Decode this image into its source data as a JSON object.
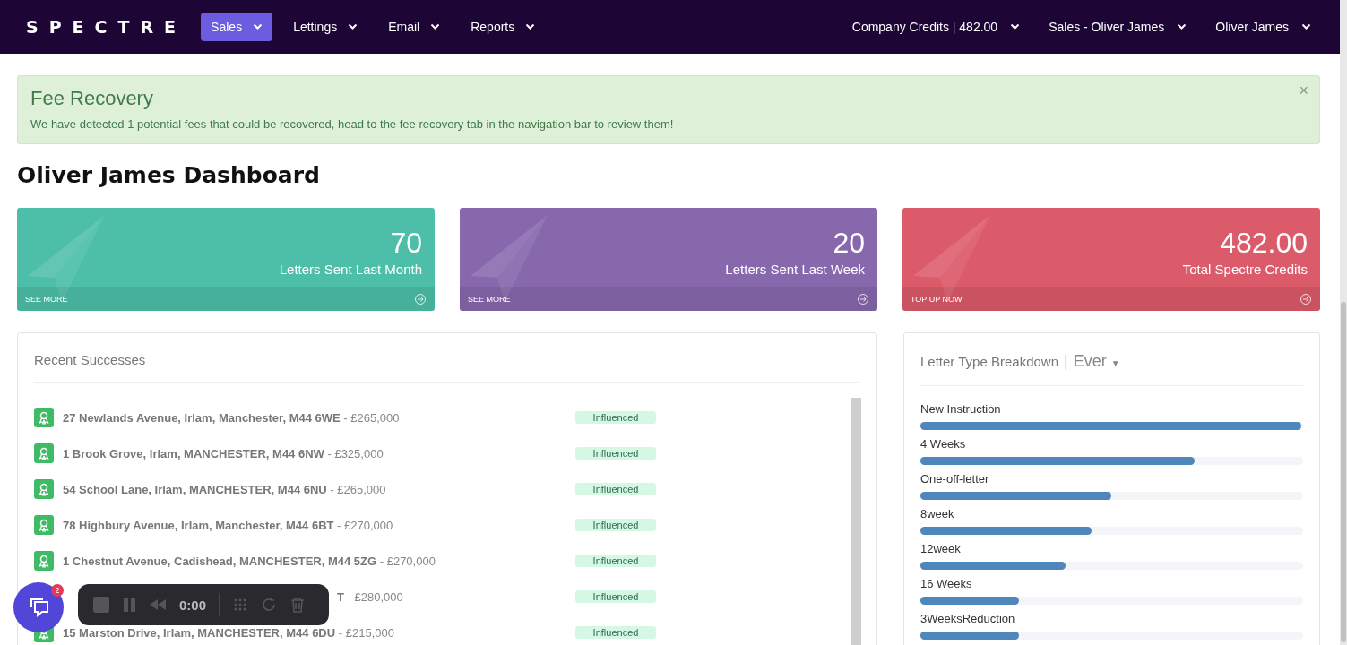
{
  "nav": {
    "logo": "SPECTRE",
    "items": [
      {
        "label": "Sales",
        "selected": true
      },
      {
        "label": "Lettings",
        "selected": false
      },
      {
        "label": "Email",
        "selected": false
      },
      {
        "label": "Reports",
        "selected": false
      }
    ],
    "right_items": [
      "Company Credits | 482.00",
      "Sales - Oliver James",
      "Oliver James"
    ]
  },
  "alert": {
    "title": "Fee Recovery",
    "message": "We have detected 1 potential fees that could be recovered, head to the fee recovery tab in the navigation bar to review them!",
    "close": "×"
  },
  "heading": "Oliver James Dashboard",
  "stats": [
    {
      "value": "70",
      "label": "Letters Sent Last Month",
      "link": "SEE MORE",
      "color": "#4dbfa9"
    },
    {
      "value": "20",
      "label": "Letters Sent Last Week",
      "link": "SEE MORE",
      "color": "#8768ad"
    },
    {
      "value": "482.00",
      "label": "Total Spectre Credits",
      "link": "TOP UP NOW",
      "color": "#dc5b6b"
    }
  ],
  "recent": {
    "title": "Recent Successes",
    "rows": [
      {
        "kind": "full",
        "address": "27 Newlands Avenue, Irlam, Manchester, M44 6WE",
        "price": "- £265,000",
        "status": "Influenced"
      },
      {
        "kind": "full",
        "address": "1 Brook Grove, Irlam, MANCHESTER, M44 6NW",
        "price": "- £325,000",
        "status": "Influenced"
      },
      {
        "kind": "full",
        "address": "54 School Lane, Irlam, MANCHESTER, M44 6NU",
        "price": "- £265,000",
        "status": "Influenced"
      },
      {
        "kind": "full",
        "address": "78 Highbury Avenue, Irlam, Manchester, M44 6BT",
        "price": "- £270,000",
        "status": "Influenced"
      },
      {
        "kind": "full",
        "address": "1 Chestnut Avenue, Cadishead, MANCHESTER, M44 5ZG",
        "price": "- £270,000",
        "status": "Influenced"
      },
      {
        "kind": "partial",
        "address": "T",
        "price": "- £280,000",
        "status": "Influenced"
      },
      {
        "kind": "full",
        "address": "15 Marston Drive, Irlam, MANCHESTER, M44 6DU",
        "price": "- £215,000",
        "status": "Influenced"
      }
    ]
  },
  "breakdown": {
    "title": "Letter Type Breakdown",
    "separator": "|",
    "period": "Ever",
    "period_caret": "▼",
    "items": [
      {
        "label": "New Instruction",
        "level": 0.995
      },
      {
        "label": "4 Weeks",
        "level": 0.716
      },
      {
        "label": "One-off-letter",
        "level": 0.498
      },
      {
        "label": "8week",
        "level": 0.448
      },
      {
        "label": "12week",
        "level": 0.379
      },
      {
        "label": "16 Weeks",
        "level": 0.257
      },
      {
        "label": "3WeeksReduction",
        "level": 0.257
      }
    ]
  },
  "chat": {
    "badge": "2"
  },
  "recorder": {
    "time": "0:00"
  }
}
